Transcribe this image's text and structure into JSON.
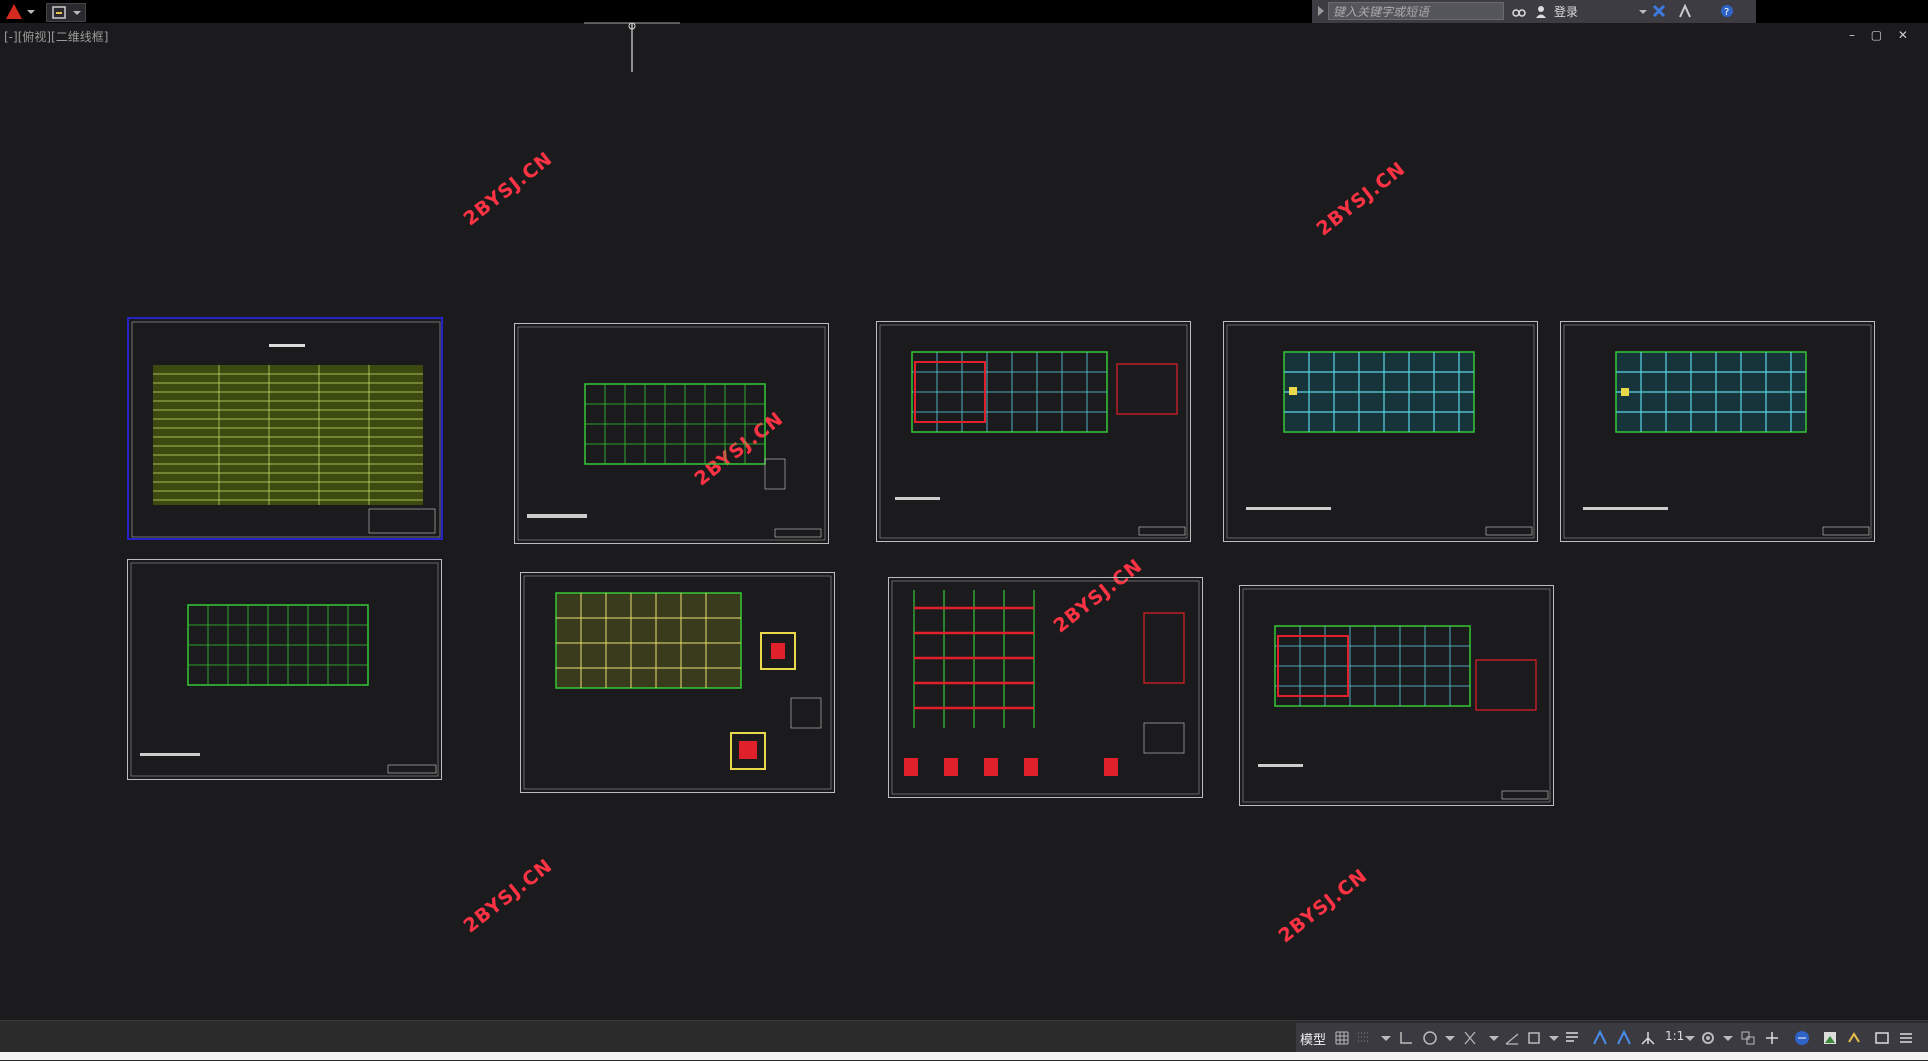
{
  "app": {
    "title": "AutoCAD",
    "viewport_label": "[-][俯视][二维线框]",
    "search_placeholder": "键入关键字或短语",
    "login_label": "登录"
  },
  "watermarks": [
    {
      "text": "2BYSJ.CN"
    },
    {
      "text": "2BYSJ.CN"
    },
    {
      "text": "2BYSJ.CN"
    },
    {
      "text": "2BYSJ.CN"
    },
    {
      "text": "2BYSJ.CN"
    },
    {
      "text": "2BYSJ.CN"
    },
    {
      "text": "2BYSJ.CN"
    }
  ],
  "drawings": [
    {
      "name": "design-notes-sheet",
      "style": "notes"
    },
    {
      "name": "foundation-plan-sheet",
      "style": "plan-green"
    },
    {
      "name": "beam-reinforcement-sheet",
      "style": "plan-red"
    },
    {
      "name": "slab-plan-sheet",
      "style": "plan-cyan"
    },
    {
      "name": "roof-slab-plan-sheet",
      "style": "plan-cyan"
    },
    {
      "name": "column-layout-sheet",
      "style": "plan-green"
    },
    {
      "name": "foundation-detail-sheet",
      "style": "plan-yellow"
    },
    {
      "name": "frame-elevation-sheet",
      "style": "elevation"
    },
    {
      "name": "beam-reinforcement-sheet-2",
      "style": "plan-red"
    }
  ],
  "statusbar": {
    "model_tab": "模型",
    "annotation_scale": "1:1"
  },
  "colors": {
    "background": "#1b1b1d",
    "sheet_border": "#bdbdbd",
    "watermark": "#ff3344",
    "grid_green": "#35c735",
    "slab_cyan": "#5cd3e6",
    "rebar_red": "#e0202a",
    "selected_border": "#2323c8"
  }
}
